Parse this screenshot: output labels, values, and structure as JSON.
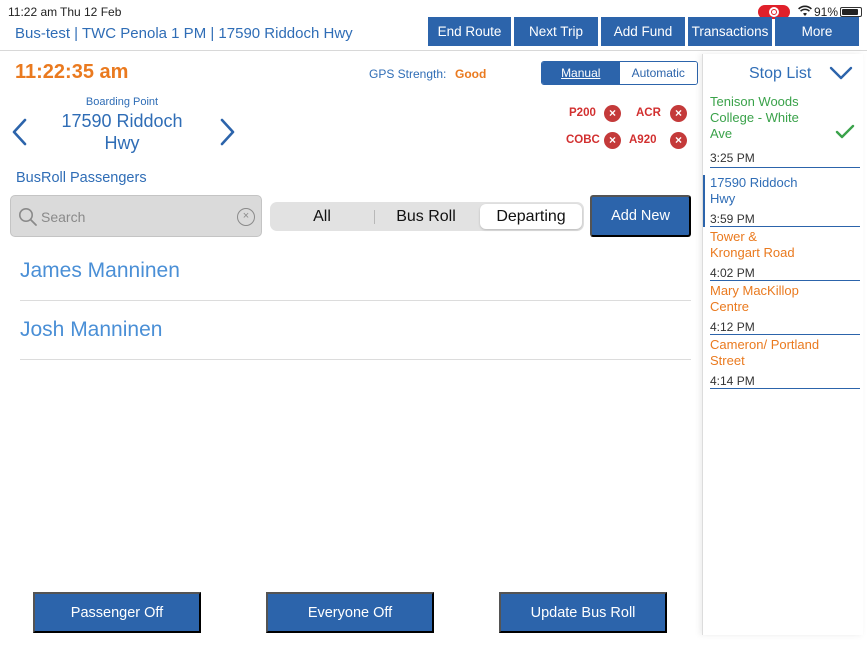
{
  "status_bar": {
    "time": "11:22 am",
    "date": "Thu 12 Feb",
    "battery": "91%"
  },
  "header": {
    "title": "Bus-test | TWC Penola 1 PM | 17590 Riddoch Hwy",
    "buttons": [
      "End Route",
      "Next Trip",
      "Add Fund",
      "Transactions",
      "More"
    ]
  },
  "clock": "11:22:35 am",
  "gps": {
    "label": "GPS Strength:",
    "value": "Good"
  },
  "mode": {
    "options": [
      "Manual",
      "Automatic"
    ],
    "selected": "Manual"
  },
  "boarding": {
    "label": "Boarding Point",
    "name": "17590 Riddoch Hwy"
  },
  "codes": [
    "P200",
    "ACR",
    "COBC",
    "A920"
  ],
  "passengers": {
    "title": "BusRoll Passengers",
    "search_placeholder": "Search",
    "filters": [
      "All",
      "Bus Roll",
      "Departing"
    ],
    "selected_filter": "Departing",
    "add_new": "Add New",
    "list": [
      "James Manninen",
      "Josh Manninen"
    ]
  },
  "actions": [
    "Passenger Off",
    "Everyone Off",
    "Update Bus Roll"
  ],
  "stop_list": {
    "title": "Stop List",
    "stops": [
      {
        "name": "Tenison Woods College - White Ave",
        "time": "3:25 PM",
        "status": "completed",
        "color": "#3aa24a"
      },
      {
        "name": "17590 Riddoch Hwy",
        "time": "3:59 PM",
        "status": "current",
        "color": "#2f6db6"
      },
      {
        "name": "Tower & Krongart Road",
        "time": "4:02 PM",
        "status": "upcoming",
        "color": "#ea7a1f"
      },
      {
        "name": "Mary MacKillop Centre",
        "time": "4:12 PM",
        "status": "upcoming",
        "color": "#ea7a1f"
      },
      {
        "name": "Cameron/ Portland Street",
        "time": "4:14 PM",
        "status": "upcoming",
        "color": "#ea7a1f"
      }
    ]
  },
  "colors": {
    "primary": "#2c64ab",
    "accent_orange": "#ea7a1f",
    "link_blue": "#4a8fd6",
    "success_green": "#3aa24a",
    "error_red": "#c43a3a"
  }
}
